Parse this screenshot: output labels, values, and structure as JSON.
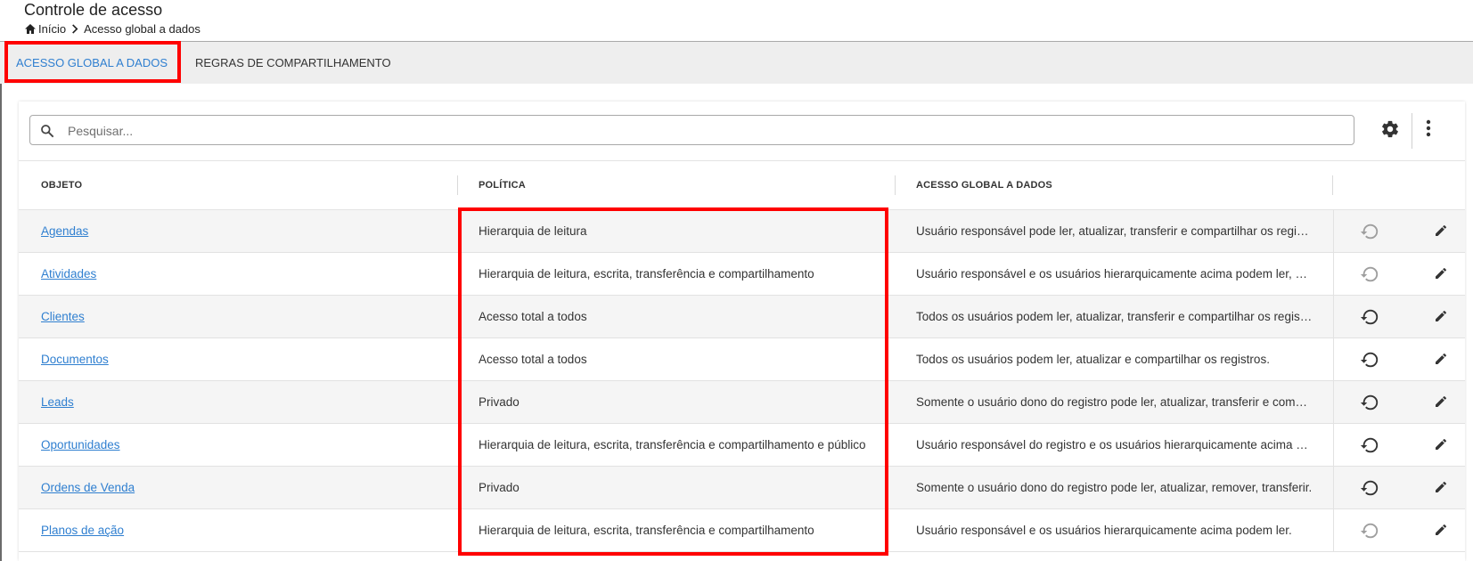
{
  "header": {
    "title": "Controle de acesso",
    "breadcrumb": {
      "home_label": "Início",
      "current": "Acesso global a dados"
    }
  },
  "tabs": [
    {
      "label": "ACESSO GLOBAL A DADOS",
      "active": true
    },
    {
      "label": "REGRAS DE COMPARTILHAMENTO",
      "active": false
    }
  ],
  "search": {
    "placeholder": "Pesquisar..."
  },
  "table": {
    "columns": [
      "OBJETO",
      "POLÍTICA",
      "ACESSO GLOBAL A DADOS"
    ],
    "rows": [
      {
        "objeto": "Agendas",
        "politica": "Hierarquia de leitura",
        "acesso": "Usuário responsável pode ler, atualizar, transferir e compartilhar os registros.",
        "reset_enabled": false
      },
      {
        "objeto": "Atividades",
        "politica": "Hierarquia de leitura, escrita, transferência e compartilhamento",
        "acesso": "Usuário responsável e os usuários hierarquicamente acima podem ler, atualizar, transferir e compartilhar os registros.",
        "reset_enabled": false
      },
      {
        "objeto": "Clientes",
        "politica": "Acesso total a todos",
        "acesso": "Todos os usuários podem ler, atualizar, transferir e compartilhar os registros.",
        "reset_enabled": true
      },
      {
        "objeto": "Documentos",
        "politica": "Acesso total a todos",
        "acesso": "Todos os usuários podem ler, atualizar e compartilhar os registros.",
        "reset_enabled": true
      },
      {
        "objeto": "Leads",
        "politica": "Privado",
        "acesso": "Somente o usuário dono do registro pode ler, atualizar, transferir e compartilhar.",
        "reset_enabled": true
      },
      {
        "objeto": "Oportunidades",
        "politica": "Hierarquia de leitura, escrita, transferência e compartilhamento e público",
        "acesso": "Usuário responsável do registro e os usuários hierarquicamente acima podem ler.",
        "reset_enabled": true
      },
      {
        "objeto": "Ordens de Venda",
        "politica": "Privado",
        "acesso": "Somente o usuário dono do registro pode ler, atualizar, remover, transferir.",
        "reset_enabled": true
      },
      {
        "objeto": "Planos de ação",
        "politica": "Hierarquia de leitura, escrita, transferência e compartilhamento",
        "acesso": "Usuário responsável e os usuários hierarquicamente acima podem ler.",
        "reset_enabled": false
      }
    ]
  },
  "colors": {
    "accent": "#2f7fd0",
    "highlight": "#ff0000",
    "icon_enabled": "#333333",
    "icon_disabled": "#9e9e9e"
  },
  "icons": [
    "home-icon",
    "chevron-right-icon",
    "search-icon",
    "gear-icon",
    "more-vert-icon",
    "reset-icon",
    "edit-pencil-icon"
  ]
}
